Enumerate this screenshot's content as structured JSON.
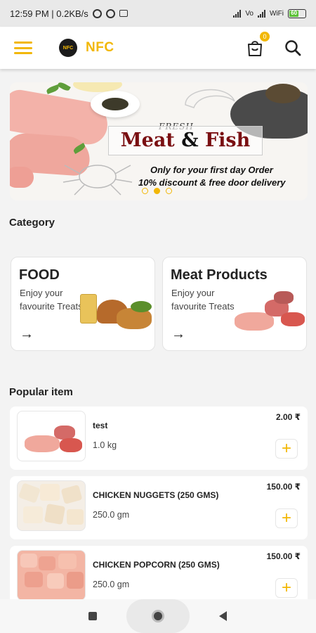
{
  "status_bar": {
    "time_info": "12:59 PM | 0.2KB/s",
    "network_labels": [
      "Vo",
      "WiFi"
    ],
    "battery": "60"
  },
  "app_bar": {
    "logo_text": "NFC",
    "brand": "NFC",
    "cart_count": "0"
  },
  "banner": {
    "eyebrow": "FRESH",
    "title_part1": "Meat",
    "title_amp": " & ",
    "title_part2": "Fish",
    "offer_line1": "Only  for your  first day Order",
    "offer_line2": "10% discount & free door delivery",
    "slide_count": 3,
    "active_slide": 2
  },
  "category": {
    "title": "Category",
    "cards": [
      {
        "title": "FOOD",
        "text": "Enjoy your favourite Treats",
        "arrow": "→"
      },
      {
        "title": "Meat Products",
        "text": "Enjoy your favourite Treats",
        "arrow": "→"
      }
    ]
  },
  "popular": {
    "title": "Popular item",
    "items": [
      {
        "name": "test",
        "qty": "1.0 kg",
        "price": "2.00 ₹",
        "add": "+"
      },
      {
        "name": "CHICKEN NUGGETS (250 GMS)",
        "qty": "250.0 gm",
        "price": "150.00 ₹",
        "add": "+"
      },
      {
        "name": "CHICKEN POPCORN (250 GMS)",
        "qty": "250.0 gm",
        "price": "150.00 ₹",
        "add": "+"
      }
    ]
  },
  "colors": {
    "accent": "#f2b705",
    "banner_title": "#7a0f12"
  },
  "icons": {
    "menu": "hamburger-icon",
    "cart": "shopping-bag-icon",
    "search": "search-icon",
    "arrow": "arrow-right-icon"
  }
}
